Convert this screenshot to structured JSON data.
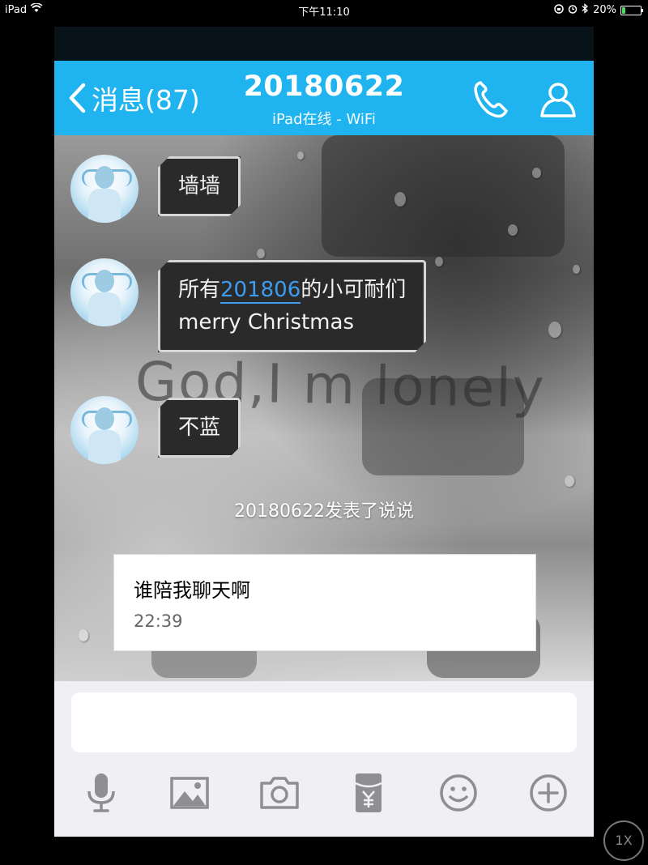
{
  "status_bar": {
    "device": "iPad",
    "time": "下午11:10",
    "battery": "20%",
    "battery_level": 0.2
  },
  "nav": {
    "back_label": "消息(87)",
    "title": "20180622",
    "subtitle": "iPad在线 - WiFi",
    "icons": [
      "phone-icon",
      "person-icon"
    ]
  },
  "messages": [
    {
      "text": "墙墙"
    },
    {
      "parts": [
        "所有",
        "201806",
        "的小可耐们"
      ],
      "line2": "merry Christmas"
    },
    {
      "text": "不蓝"
    }
  ],
  "background_text": "God,I m lonely",
  "system_notice": "20180622发表了说说",
  "post_card": {
    "text": "谁陪我聊天啊",
    "time": "22:39"
  },
  "toolbar": [
    "microphone-icon",
    "image-icon",
    "camera-icon",
    "red-packet-icon",
    "emoji-icon",
    "plus-icon"
  ],
  "overlay_badge": "1X",
  "colors": {
    "nav_bg": "#1fb3f0",
    "link": "#3b9cf0"
  }
}
